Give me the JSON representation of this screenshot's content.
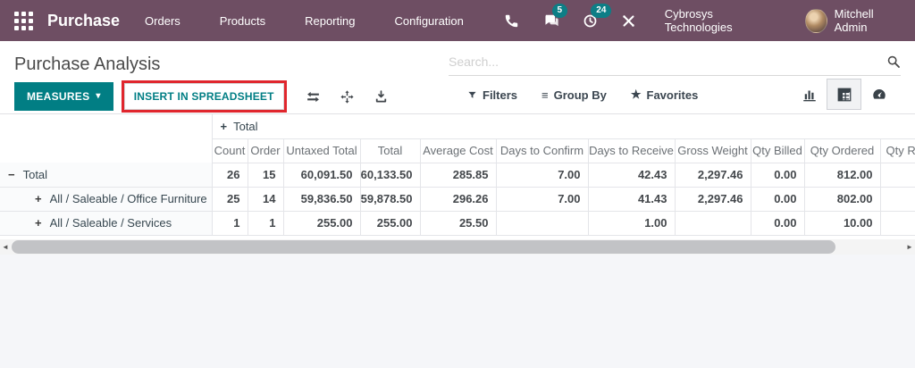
{
  "nav": {
    "app_name": "Purchase",
    "menu_items": [
      "Orders",
      "Products",
      "Reporting",
      "Configuration"
    ],
    "messages_count": "5",
    "activities_count": "24",
    "company": "Cybrosys Technologies",
    "user": "Mitchell Admin"
  },
  "page": {
    "title": "Purchase Analysis"
  },
  "search": {
    "placeholder": "Search..."
  },
  "controls": {
    "measures_label": "MEASURES",
    "insert_spreadsheet_label": "INSERT IN SPREADSHEET",
    "filters_label": "Filters",
    "group_by_label": "Group By",
    "favorites_label": "Favorites"
  },
  "icons": {
    "caret_down": "▾",
    "plus": "+",
    "star": "★",
    "menu_lines": "≡",
    "arrow_left": "◄",
    "arrow_right": "►"
  },
  "colors": {
    "navbar_bg": "#6e4e63",
    "badge_teal": "#0d7e86",
    "primary_teal": "#017e84",
    "highlight_red": "#e0262d"
  },
  "pivot": {
    "col_group_label": "Total",
    "columns": [
      "Count",
      "Order",
      "Untaxed Total",
      "Total",
      "Average Cost",
      "Days to Confirm",
      "Days to Receive",
      "Gross Weight",
      "Qty Billed",
      "Qty Ordered",
      "Qty Re"
    ],
    "rows": [
      {
        "expander": "−",
        "label": "Total",
        "values": [
          "26",
          "15",
          "60,091.50",
          "60,133.50",
          "285.85",
          "7.00",
          "42.43",
          "2,297.46",
          "0.00",
          "812.00",
          ""
        ]
      },
      {
        "expander": "+",
        "label": "All / Saleable / Office Furniture",
        "values": [
          "25",
          "14",
          "59,836.50",
          "59,878.50",
          "296.26",
          "7.00",
          "41.43",
          "2,297.46",
          "0.00",
          "802.00",
          ""
        ]
      },
      {
        "expander": "+",
        "label": "All / Saleable / Services",
        "values": [
          "1",
          "1",
          "255.00",
          "255.00",
          "25.50",
          "",
          "1.00",
          "",
          "0.00",
          "10.00",
          ""
        ]
      }
    ]
  }
}
